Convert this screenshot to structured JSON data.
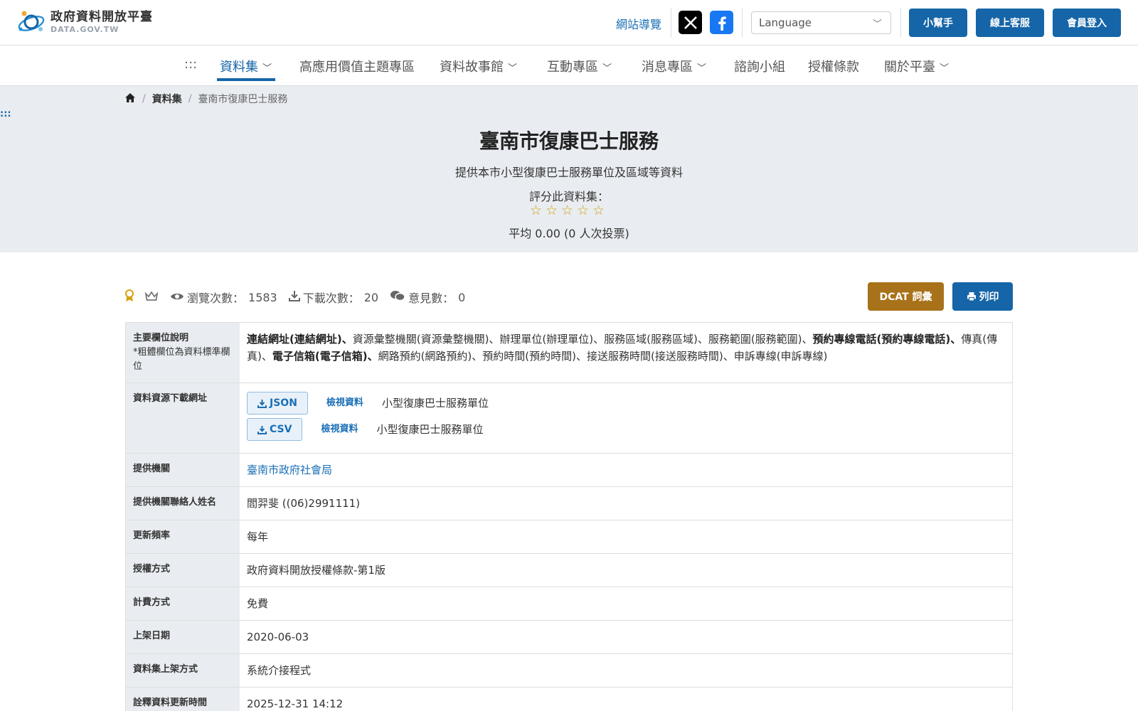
{
  "header": {
    "logo_title": "政府資料開放平臺",
    "logo_sub": "DATA.GOV.TW",
    "site_nav": "網站導覽",
    "language_placeholder": "Language",
    "btn_helper": "小幫手",
    "btn_support": "線上客服",
    "btn_login": "會員登入"
  },
  "nav": {
    "skip": ":::",
    "items": [
      "資料集",
      "高應用價值主題專區",
      "資料故事館",
      "互動專區",
      "消息專區",
      "諮詢小組",
      "授權條款",
      "關於平臺"
    ]
  },
  "breadcrumb": {
    "level1": "資料集",
    "current": "臺南市復康巴士服務"
  },
  "hero": {
    "skip": ":::",
    "title": "臺南市復康巴士服務",
    "description": "提供本市小型復康巴士服務單位及區域等資料",
    "rate_label": "評分此資料集：",
    "stars": "☆☆☆☆☆",
    "rating_text": "平均 0.00 (0 人次投票)",
    "rating_value": 0
  },
  "stats": {
    "views_label": "瀏覽次數：",
    "views": "1583",
    "downloads_label": "下載次數：",
    "downloads": "20",
    "comments_label": "意見數：",
    "comments": "0",
    "btn_dcat": "DCAT 詞彙",
    "btn_print": "列印"
  },
  "table": {
    "fields_label": "主要欄位說明",
    "fields_note": "*粗體欄位為資料標準欄位",
    "fields": [
      {
        "text": "連結網址(連結網址)、",
        "bold": true
      },
      {
        "text": "資源彙整機關(資源彙整機關)、辦理單位(辦理單位)、服務區域(服務區域)、服務範圍(服務範圍)、",
        "bold": false
      },
      {
        "text": "預約專線電話(預約專線電話)、",
        "bold": true
      },
      {
        "text": "傳真(傳真)、",
        "bold": false
      },
      {
        "text": "電子信箱(電子信箱)、",
        "bold": true
      },
      {
        "text": "網路預約(網路預約)、預約時間(預約時間)、接送服務時間(接送服務時間)、申訴專線(申訴專線)",
        "bold": false
      }
    ],
    "resources_label": "資料資源下載網址",
    "resources": [
      {
        "format": "JSON",
        "view": "檢視資料",
        "name": "小型復康巴士服務單位"
      },
      {
        "format": "CSV",
        "view": "檢視資料",
        "name": "小型復康巴士服務單位"
      }
    ],
    "rows": [
      {
        "label": "提供機關",
        "value": "臺南市政府社會局",
        "link": true
      },
      {
        "label": "提供機關聯絡人姓名",
        "value": "閻羿斐 ((06)2991111)",
        "link": false
      },
      {
        "label": "更新頻率",
        "value": "每年",
        "link": false
      },
      {
        "label": "授權方式",
        "value": "政府資料開放授權條款-第1版",
        "link": false
      },
      {
        "label": "計費方式",
        "value": "免費",
        "link": false
      },
      {
        "label": "上架日期",
        "value": "2020-06-03",
        "link": false
      },
      {
        "label": "資料集上架方式",
        "value": "系統介接程式",
        "link": false
      },
      {
        "label": "詮釋資料更新時間",
        "value": "2025-12-31 14:12",
        "link": false
      }
    ]
  },
  "colors": {
    "primary": "#1565a8",
    "gold": "#a8721a",
    "star": "#d4a10e",
    "hero_bg": "#e9edf1"
  }
}
